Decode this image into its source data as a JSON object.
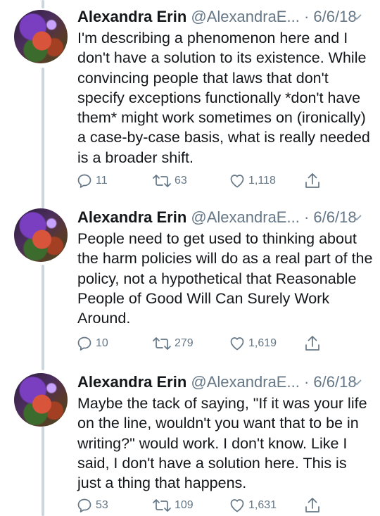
{
  "tweets": [
    {
      "name": "Alexandra Erin",
      "handle": "@AlexandraE...",
      "separator": "·",
      "date": "6/6/18",
      "text": "I'm describing a phenomenon here and I don't have a solution to its existence. While convincing people that laws that don't specify exceptions functionally *don't have them* might work sometimes on (ironically) a case-by-case basis, what is really needed is a broader shift.",
      "replies": "11",
      "retweets": "63",
      "likes": "1,118"
    },
    {
      "name": "Alexandra Erin",
      "handle": "@AlexandraE...",
      "separator": "·",
      "date": "6/6/18",
      "text": "People need to get used to thinking about the harm policies will do as a real part of the policy, not a hypothetical that Reasonable People of Good Will Can Surely Work Around.",
      "replies": "10",
      "retweets": "279",
      "likes": "1,619"
    },
    {
      "name": "Alexandra Erin",
      "handle": "@AlexandraE...",
      "separator": "·",
      "date": "6/6/18",
      "text": "Maybe the tack of saying, \"If it was your life on the line, wouldn't you want that to be in writing?\" would work. I don't know. Like I said, I don't have a solution here. This is just a thing that happens.",
      "replies": "53",
      "retweets": "109",
      "likes": "1,631"
    }
  ],
  "icons": {
    "reply": "reply-icon",
    "retweet": "retweet-icon",
    "like": "heart-icon",
    "share": "share-icon",
    "more": "chevron-down-icon"
  },
  "colors": {
    "name": "#14171a",
    "secondary": "#657786",
    "thread_line": "#ccd6dd"
  }
}
